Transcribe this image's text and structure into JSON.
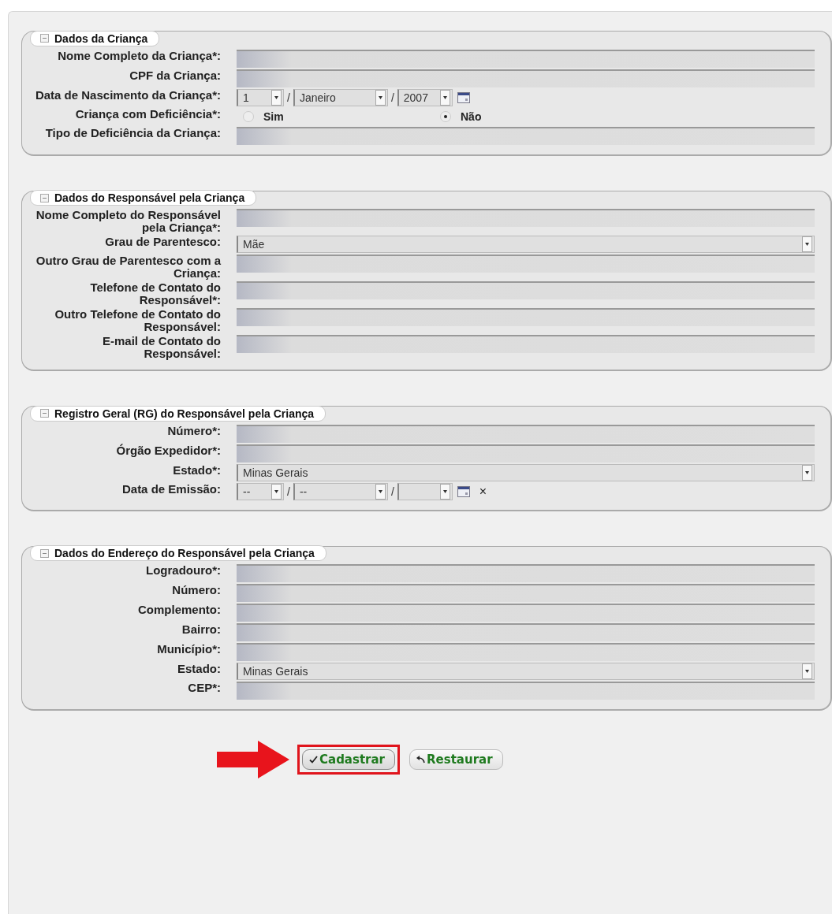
{
  "sections": [
    {
      "title": "Dados da Criança",
      "fields": [
        {
          "kind": "text",
          "label": "Nome Completo da Criança*:"
        },
        {
          "kind": "text",
          "label": "CPF da Criança:"
        },
        {
          "kind": "date",
          "label": "Data de Nascimento da Criança*:",
          "separator": "/",
          "day": "1",
          "month": "Janeiro",
          "year": "2007"
        },
        {
          "kind": "radio",
          "label": "Criança com Deficiência*:",
          "options": [
            {
              "label": "Sim",
              "selected": false
            },
            {
              "label": "Não",
              "selected": true
            }
          ]
        },
        {
          "kind": "text",
          "label": "Tipo de Deficiência da Criança:"
        }
      ]
    },
    {
      "title": "Dados do Responsável pela Criança",
      "fields": [
        {
          "kind": "text",
          "label": "Nome Completo do Responsável pela Criança*:"
        },
        {
          "kind": "select",
          "label": "Grau de Parentesco:",
          "value": "Mãe"
        },
        {
          "kind": "text",
          "label": "Outro Grau de Parentesco com a Criança:"
        },
        {
          "kind": "text",
          "label": "Telefone de Contato do Responsável*:"
        },
        {
          "kind": "text",
          "label": "Outro Telefone de Contato do Responsável:"
        },
        {
          "kind": "text",
          "label": "E-mail de Contato do Responsável:"
        }
      ]
    },
    {
      "title": "Registro Geral (RG) do Responsável pela Criança",
      "fields": [
        {
          "kind": "text",
          "label": "Número*:"
        },
        {
          "kind": "text",
          "label": "Órgão Expedidor*:"
        },
        {
          "kind": "select",
          "label": "Estado*:",
          "value": "Minas Gerais"
        },
        {
          "kind": "date",
          "label": "Data de Emissão:",
          "separator": "/",
          "day": "--",
          "month": "--",
          "clear": "×"
        }
      ]
    },
    {
      "title": "Dados do Endereço do Responsável pela Criança",
      "fields": [
        {
          "kind": "text",
          "label": "Logradouro*:"
        },
        {
          "kind": "text",
          "label": "Número:"
        },
        {
          "kind": "text",
          "label": "Complemento:"
        },
        {
          "kind": "text",
          "label": "Bairro:"
        },
        {
          "kind": "text",
          "label": "Município*:"
        },
        {
          "kind": "select",
          "label": "Estado:",
          "value": "Minas Gerais"
        },
        {
          "kind": "text",
          "label": "CEP*:"
        }
      ]
    }
  ],
  "buttons": [
    {
      "kind": "submit",
      "label": "Cadastrar",
      "highlighted": true
    },
    {
      "kind": "reset",
      "label": "Restaurar",
      "highlighted": false
    }
  ]
}
